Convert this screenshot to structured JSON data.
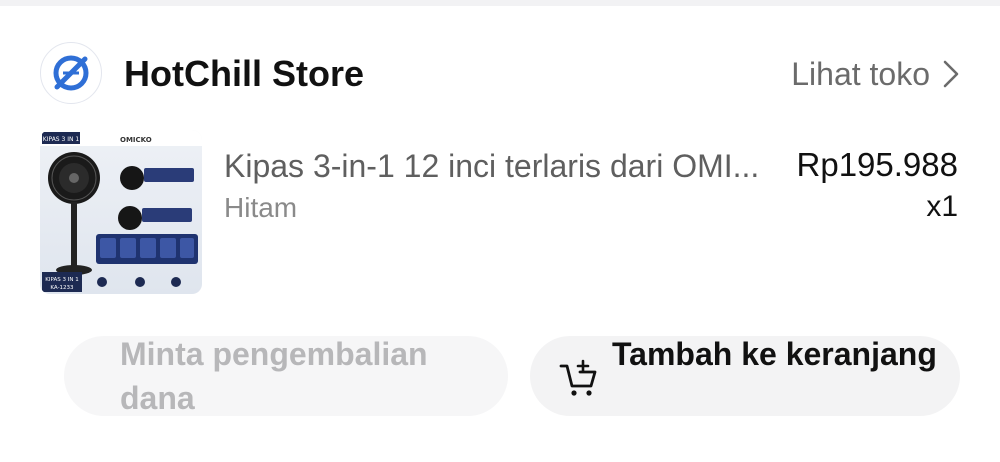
{
  "store": {
    "name": "HotChill Store",
    "link_label": "Lihat toko",
    "logo_icon": "store-logo-icon"
  },
  "product": {
    "title": "Kipas 3-in-1 12 inci terlaris dari OMI...",
    "variant": "Hitam",
    "price": "Rp195.988",
    "quantity": "x1",
    "thumbnail": {
      "brand": "OMICKO",
      "badge_top": "KIPAS 3 IN 1",
      "badge_bottom": "KIPAS 3 IN 1",
      "model": "KA-1233"
    }
  },
  "actions": {
    "refund_label": "Minta pengembalian dana",
    "add_to_cart_label": "Tambah ke keranjang"
  },
  "colors": {
    "accent_blue": "#2f6fd6",
    "text_primary": "#111111",
    "text_secondary": "#6b6b6b",
    "disabled_text": "#b7b7b9"
  }
}
